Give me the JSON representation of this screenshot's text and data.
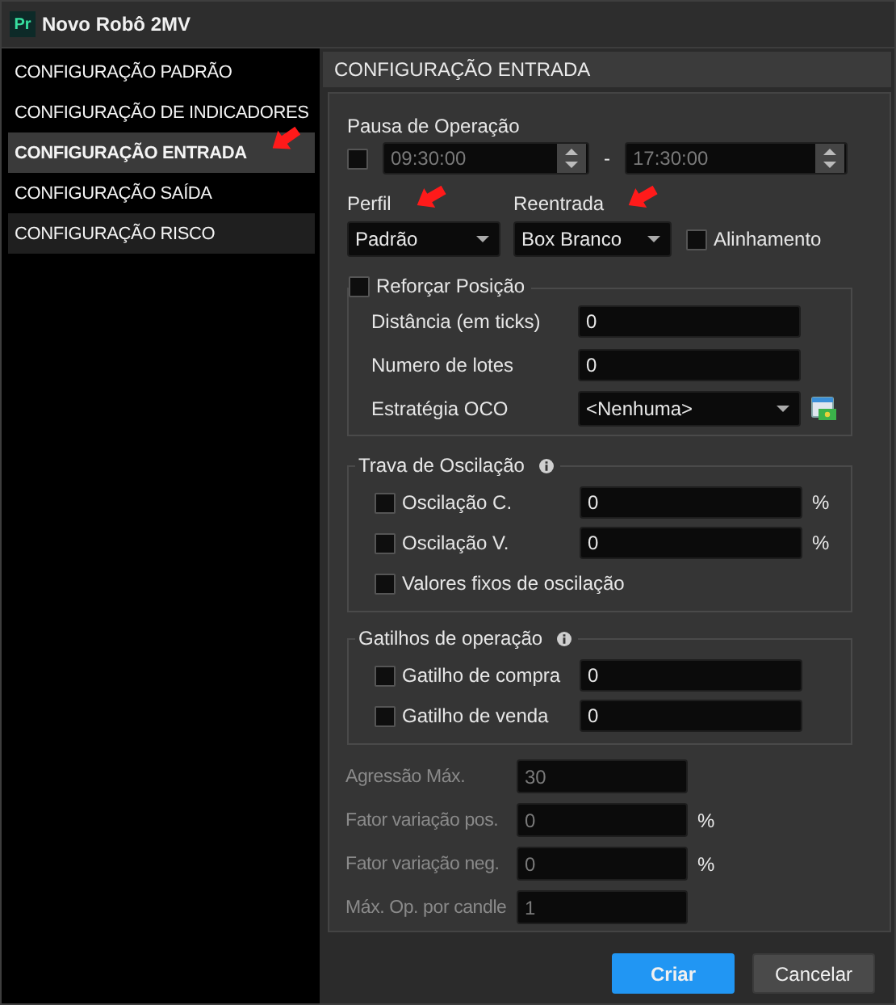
{
  "window": {
    "title": "Novo Robô 2MV",
    "logo": "Pr"
  },
  "sidebar": {
    "items": [
      {
        "label": "CONFIGURAÇÃO PADRÃO",
        "selected": false,
        "hovered": false
      },
      {
        "label": "CONFIGURAÇÃO DE INDICADORES",
        "selected": false,
        "hovered": false
      },
      {
        "label": "CONFIGURAÇÃO ENTRADA",
        "selected": true,
        "hovered": false
      },
      {
        "label": "CONFIGURAÇÃO SAÍDA",
        "selected": false,
        "hovered": false
      },
      {
        "label": "CONFIGURAÇÃO RISCO",
        "selected": false,
        "hovered": true
      }
    ]
  },
  "panel": {
    "title": "CONFIGURAÇÃO ENTRADA"
  },
  "pausa": {
    "label": "Pausa de Operação",
    "checked": false,
    "start": "09:30:00",
    "separator": "-",
    "end": "17:30:00"
  },
  "perfil": {
    "label": "Perfil",
    "value": "Padrão"
  },
  "reentrada": {
    "label": "Reentrada",
    "value": "Box Branco"
  },
  "alinhamento": {
    "label": "Alinhamento",
    "checked": false
  },
  "reforcar": {
    "label": "Reforçar Posição",
    "checked": false,
    "fields": [
      {
        "kind": "input",
        "label": "Distância (em ticks)",
        "value": "0"
      },
      {
        "kind": "input",
        "label": "Numero de lotes",
        "value": "0"
      },
      {
        "kind": "select",
        "label": "Estratégia OCO",
        "value": "<Nenhuma>"
      }
    ]
  },
  "trava": {
    "title": "Trava de Oscilação",
    "rows": [
      {
        "label": "Oscilação C.",
        "checked": false,
        "value": "0",
        "unit": "%"
      },
      {
        "label": "Oscilação V.",
        "checked": false,
        "value": "0",
        "unit": "%"
      },
      {
        "label": "Valores fixos de oscilação",
        "checked": false
      }
    ]
  },
  "gatilhos": {
    "title": "Gatilhos de operação",
    "rows": [
      {
        "label": "Gatilho de compra",
        "checked": false,
        "value": "0"
      },
      {
        "label": "Gatilho de venda",
        "checked": false,
        "value": "0"
      }
    ]
  },
  "limits": [
    {
      "label": "Agressão Máx.",
      "value": "30",
      "disabled": true
    },
    {
      "label": "Fator variação pos.",
      "value": "0",
      "unit": "%",
      "disabled": true
    },
    {
      "label": "Fator variação neg.",
      "value": "0",
      "unit": "%",
      "disabled": true
    },
    {
      "label": "Máx. Op. por candle",
      "value": "1",
      "disabled": true
    }
  ],
  "buttons": [
    {
      "label": "Criar",
      "kind": "primary"
    },
    {
      "label": "Cancelar",
      "kind": "secondary"
    }
  ]
}
